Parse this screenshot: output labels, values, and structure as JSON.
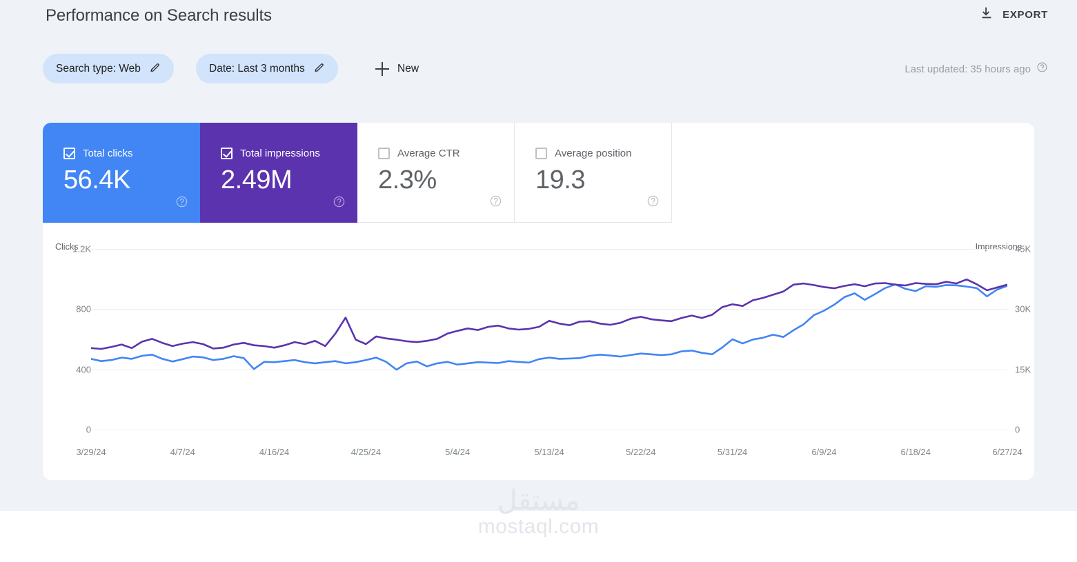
{
  "header": {
    "title": "Performance on Search results",
    "export_label": "EXPORT",
    "export_icon": "download-icon"
  },
  "filters": {
    "chips": [
      {
        "label": "Search type: Web",
        "icon": "pencil-icon"
      },
      {
        "label": "Date: Last 3 months",
        "icon": "pencil-icon"
      }
    ],
    "new_label": "New",
    "new_icon": "plus-icon",
    "last_updated": "Last updated: 35 hours ago",
    "help_icon": "help-circle-icon"
  },
  "metrics": [
    {
      "name": "Total clicks",
      "value": "56.4K",
      "checked": true,
      "color": "#4285f4",
      "help_icon": "help-circle-icon"
    },
    {
      "name": "Total impressions",
      "value": "2.49M",
      "checked": true,
      "color": "#5c33ae",
      "help_icon": "help-circle-icon"
    },
    {
      "name": "Average CTR",
      "value": "2.3%",
      "checked": false,
      "color": "#5f6368",
      "help_icon": "help-circle-icon"
    },
    {
      "name": "Average position",
      "value": "19.3",
      "checked": false,
      "color": "#5f6368",
      "help_icon": "help-circle-icon"
    }
  ],
  "watermark": {
    "arabic": "مستقل",
    "latin": "mostaql.com"
  },
  "chart_data": {
    "type": "line",
    "title": "",
    "xlabel": "",
    "grid": true,
    "legend": "none",
    "left_axis": {
      "label": "Clicks",
      "ticks": [
        "0",
        "400",
        "800",
        "1.2K"
      ],
      "ylim": [
        0,
        1200
      ],
      "color": "#4285f4"
    },
    "right_axis": {
      "label": "Impressions",
      "ticks": [
        "0",
        "15K",
        "30K",
        "45K"
      ],
      "ylim": [
        0,
        45000
      ],
      "color": "#5c33ae"
    },
    "x_ticks": [
      "3/29/24",
      "4/7/24",
      "4/16/24",
      "4/25/24",
      "5/4/24",
      "5/13/24",
      "5/22/24",
      "5/31/24",
      "6/9/24",
      "6/18/24",
      "6/27/24"
    ],
    "x_tick_index": [
      0,
      9,
      18,
      27,
      36,
      45,
      54,
      63,
      72,
      81,
      90
    ],
    "n_points": 91,
    "series": [
      {
        "name": "Total clicks",
        "axis": "left",
        "color": "#4285f4",
        "values": [
          470,
          455,
          462,
          478,
          470,
          490,
          498,
          470,
          452,
          468,
          485,
          480,
          462,
          470,
          488,
          475,
          402,
          450,
          448,
          455,
          462,
          448,
          440,
          448,
          455,
          440,
          448,
          462,
          478,
          450,
          398,
          440,
          452,
          420,
          440,
          450,
          432,
          440,
          448,
          445,
          442,
          455,
          450,
          445,
          468,
          478,
          470,
          472,
          475,
          490,
          498,
          492,
          485,
          495,
          505,
          500,
          495,
          500,
          520,
          525,
          510,
          500,
          545,
          600,
          572,
          598,
          610,
          630,
          615,
          660,
          700,
          760,
          790,
          830,
          880,
          905,
          862,
          900,
          940,
          965,
          935,
          920,
          952,
          948,
          960,
          958,
          950,
          940,
          885,
          930,
          955
        ]
      },
      {
        "name": "Total impressions",
        "axis": "right",
        "color": "#5c33ae",
        "values": [
          20300,
          20100,
          20600,
          21200,
          20300,
          21900,
          22600,
          21600,
          20800,
          21400,
          21800,
          21300,
          20200,
          20400,
          21200,
          21600,
          21000,
          20800,
          20400,
          21000,
          21800,
          21300,
          22100,
          20800,
          23900,
          27900,
          22400,
          21300,
          23200,
          22700,
          22400,
          22000,
          21800,
          22100,
          22600,
          23900,
          24600,
          25200,
          24800,
          25600,
          25900,
          25200,
          24900,
          25100,
          25600,
          27100,
          26400,
          26000,
          26900,
          27000,
          26400,
          26100,
          26600,
          27600,
          28100,
          27500,
          27200,
          27000,
          27800,
          28400,
          27800,
          28600,
          30500,
          31200,
          30800,
          32200,
          32800,
          33600,
          34400,
          36100,
          36400,
          36000,
          35500,
          35200,
          35800,
          36200,
          35700,
          36400,
          36500,
          36100,
          35900,
          36500,
          36300,
          36200,
          36800,
          36400,
          37400,
          36200,
          34700,
          35400,
          36100
        ]
      }
    ]
  }
}
